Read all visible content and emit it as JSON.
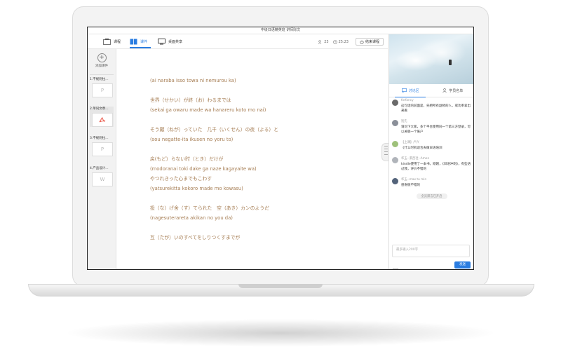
{
  "window": {
    "title": "中级日语精英班 讲师际文"
  },
  "toolbar": {
    "items": [
      {
        "label": "课程",
        "icon": "book-icon"
      },
      {
        "label": "课件",
        "icon": "courseware-icon"
      },
      {
        "label": "桌面共享",
        "icon": "monitor-icon"
      }
    ],
    "stats": {
      "students": "23",
      "time": "25:23"
    },
    "end_label": "结束课程"
  },
  "sidebar": {
    "add_label": "添加课件",
    "items": [
      {
        "label": "1.不规则拉...",
        "icon": "P"
      },
      {
        "label": "2.单词文章...",
        "icon": "pdf"
      },
      {
        "label": "3.不规则拉...",
        "icon": "P"
      },
      {
        "label": "4.产品设计...",
        "icon": "W"
      }
    ]
  },
  "document": {
    "lines": [
      "(ai naraba isso towa ni nemurou ka)",
      "",
      "世界（せかい）が終（お）わるまでは",
      "(sekai ga owaru made wa hanareru koto mo nai)",
      "",
      "そう願（ねが）っていた　几千（いくせん）の夜（よる）と",
      "(sou negatte-ita ikusen no yoru to)",
      "",
      "戻(もど）らない时（とき）だけが",
      "(modoranai toki dake ga naze kagayaite wa)",
      "やつれきった心までもこわす",
      "(yatsurekitta kokoro made mo kowasu)",
      "",
      "投（な）げ舍（す）てられた　空（あき）カンのようだ",
      "(nagesuterareta akikan no you da)",
      "",
      "互（たが）いのすべてをしりつくすまでが"
    ]
  },
  "chat": {
    "tabs": [
      {
        "label": "讨论区",
        "icon": "chat-icon"
      },
      {
        "label": "学员名单",
        "icon": "user-icon"
      }
    ],
    "messages": [
      {
        "name": "forfancy",
        "text": "这句话的前面是，先把所有副修的人，或功率拿出来看"
      },
      {
        "name": "别先",
        "text": "请问下大家，多个平台使用同一个第三方登录，可以关联一个账户"
      },
      {
        "name": "【上课】卢兴",
        "text": "《什么时机适合去做日语培训"
      },
      {
        "name": "华玉--莱西社--Amen",
        "text": "kindle使用了一本书，刚刚，《日语冲刺》，有些语过我，评价不错的"
      },
      {
        "name": "华玉--max to min",
        "text": "感谢很不错的"
      }
    ],
    "notice": "全员禁言已开启",
    "input_placeholder": "最多输入200字",
    "send_label": "发送"
  }
}
